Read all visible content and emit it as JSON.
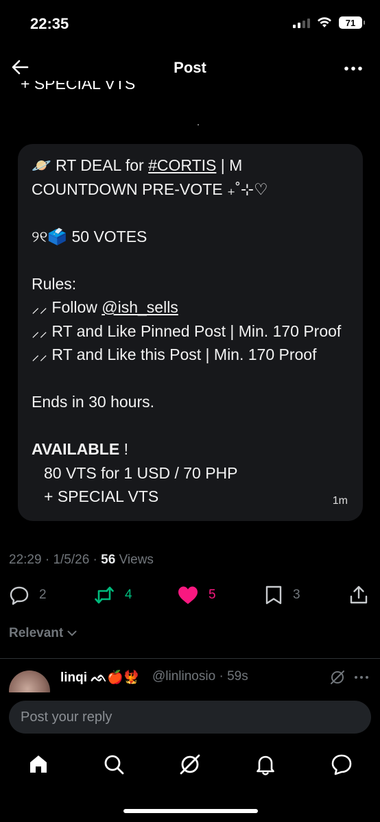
{
  "status_bar": {
    "time": "22:35",
    "battery": "71"
  },
  "nav": {
    "title": "Post"
  },
  "clipped_text": "+ SPECIAL VTS",
  "post": {
    "line1_prefix": "🪐 RT DEAL for ",
    "hashtag": "#CORTIS",
    "line1_suffix": "  |  M",
    "line2": "COUNTDOWN PRE-VOTE ₊˚⊹♡",
    "votes_line": "୨୧🗳️ 50 VOTES",
    "rules_title": "Rules:",
    "rule1_prefix": "⸝⸝ Follow ",
    "rule1_mention": "@ish_sells",
    "rule2": "⸝⸝ RT and Like Pinned Post | Min. 170 Proof",
    "rule3": "⸝⸝ RT and Like this Post | Min. 170 Proof",
    "ends": "Ends in 30 hours.",
    "available_label": "AVAILABLE",
    "available_suffix": " !",
    "price_line": "80 VTS for 1 USD / 70 PHP",
    "special_line": "+ SPECIAL VTS",
    "age": "1m"
  },
  "meta": {
    "time": "22:29",
    "date": "1/5/26",
    "views_count": "56",
    "views_label": "Views"
  },
  "actions": {
    "replies": "2",
    "reposts": "4",
    "likes": "5",
    "bookmarks": "3"
  },
  "colors": {
    "repost_green": "#00ba7c",
    "like_pink": "#f91880",
    "muted": "#71767b"
  },
  "sort": {
    "label": "Relevant"
  },
  "reply": {
    "name": "linqi",
    "name_emoji": " ᨒ🍎🐦‍🔥",
    "handle": "@linlinosio",
    "age": "59s"
  },
  "composer": {
    "placeholder": "Post your reply"
  },
  "tabs": [
    {
      "icon": "home-icon"
    },
    {
      "icon": "search-icon"
    },
    {
      "icon": "grok-icon"
    },
    {
      "icon": "bell-icon"
    },
    {
      "icon": "messages-icon"
    }
  ]
}
